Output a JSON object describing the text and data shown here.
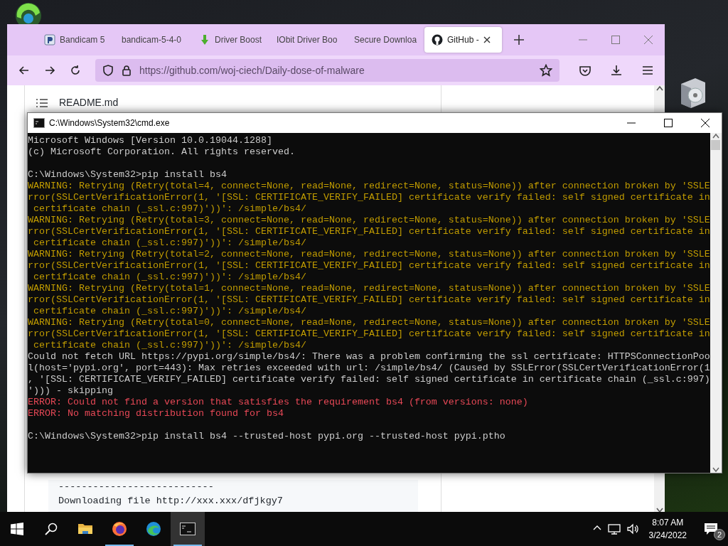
{
  "browser": {
    "tabs": [
      {
        "label": "Bandicam 5",
        "kind": "bandicam",
        "selected": false
      },
      {
        "label": "bandicam-5-4-0",
        "kind": "plain",
        "selected": false
      },
      {
        "label": "Driver Boost",
        "kind": "download",
        "selected": false
      },
      {
        "label": "IObit Driver Boo",
        "kind": "plain",
        "selected": false
      },
      {
        "label": "Secure Downloa",
        "kind": "plain",
        "selected": false
      },
      {
        "label": "GitHub - ",
        "kind": "github",
        "selected": true
      }
    ],
    "url": "https://github.com/woj-ciech/Daily-dose-of-malware",
    "readme_title": "README.md",
    "code_lines": [
      "---------------------------",
      "Downloading file http://xxx.xxx/dfjkgy7"
    ]
  },
  "cmd": {
    "title": "C:\\Windows\\System32\\cmd.exe",
    "lines": [
      {
        "kind": "normal",
        "text": "Microsoft Windows [Version 10.0.19044.1288]"
      },
      {
        "kind": "normal",
        "text": "(c) Microsoft Corporation. All rights reserved."
      },
      {
        "kind": "blank"
      },
      {
        "kind": "normal",
        "text": "C:\\Windows\\System32>pip install bs4"
      },
      {
        "kind": "warning",
        "text": "WARNING: Retrying (Retry(total=4, connect=None, read=None, redirect=None, status=None)) after connection broken by 'SSLE"
      },
      {
        "kind": "warning",
        "text": "rror(SSLCertVerificationError(1, '[SSL: CERTIFICATE_VERIFY_FAILED] certificate verify failed: self signed certificate in"
      },
      {
        "kind": "warning",
        "text": " certificate chain (_ssl.c:997)'))': /simple/bs4/"
      },
      {
        "kind": "warning",
        "text": "WARNING: Retrying (Retry(total=3, connect=None, read=None, redirect=None, status=None)) after connection broken by 'SSLE"
      },
      {
        "kind": "warning",
        "text": "rror(SSLCertVerificationError(1, '[SSL: CERTIFICATE_VERIFY_FAILED] certificate verify failed: self signed certificate in"
      },
      {
        "kind": "warning",
        "text": " certificate chain (_ssl.c:997)'))': /simple/bs4/"
      },
      {
        "kind": "warning",
        "text": "WARNING: Retrying (Retry(total=2, connect=None, read=None, redirect=None, status=None)) after connection broken by 'SSLE"
      },
      {
        "kind": "warning",
        "text": "rror(SSLCertVerificationError(1, '[SSL: CERTIFICATE_VERIFY_FAILED] certificate verify failed: self signed certificate in"
      },
      {
        "kind": "warning",
        "text": " certificate chain (_ssl.c:997)'))': /simple/bs4/"
      },
      {
        "kind": "warning",
        "text": "WARNING: Retrying (Retry(total=1, connect=None, read=None, redirect=None, status=None)) after connection broken by 'SSLE"
      },
      {
        "kind": "warning",
        "text": "rror(SSLCertVerificationError(1, '[SSL: CERTIFICATE_VERIFY_FAILED] certificate verify failed: self signed certificate in"
      },
      {
        "kind": "warning",
        "text": " certificate chain (_ssl.c:997)'))': /simple/bs4/"
      },
      {
        "kind": "warning",
        "text": "WARNING: Retrying (Retry(total=0, connect=None, read=None, redirect=None, status=None)) after connection broken by 'SSLE"
      },
      {
        "kind": "warning",
        "text": "rror(SSLCertVerificationError(1, '[SSL: CERTIFICATE_VERIFY_FAILED] certificate verify failed: self signed certificate in"
      },
      {
        "kind": "warning",
        "text": " certificate chain (_ssl.c:997)'))': /simple/bs4/"
      },
      {
        "kind": "normal",
        "text": "Could not fetch URL https://pypi.org/simple/bs4/: There was a problem confirming the ssl certificate: HTTPSConnectionPoo"
      },
      {
        "kind": "normal",
        "text": "l(host='pypi.org', port=443): Max retries exceeded with url: /simple/bs4/ (Caused by SSLError(SSLCertVerificationError(1"
      },
      {
        "kind": "normal",
        "text": ", '[SSL: CERTIFICATE_VERIFY_FAILED] certificate verify failed: self signed certificate in certificate chain (_ssl.c:997)"
      },
      {
        "kind": "normal",
        "text": "'))) - skipping"
      },
      {
        "kind": "error",
        "text": "ERROR: Could not find a version that satisfies the requirement bs4 (from versions: none)"
      },
      {
        "kind": "error",
        "text": "ERROR: No matching distribution found for bs4"
      },
      {
        "kind": "blank"
      },
      {
        "kind": "normal",
        "text": "C:\\Windows\\System32>pip install bs4 --trusted-host pypi.org --trusted-host pypi.ptho"
      }
    ]
  },
  "taskbar": {
    "apps": [
      {
        "kind": "explorer",
        "running": false,
        "active": false
      },
      {
        "kind": "firefox",
        "running": true,
        "active": false
      },
      {
        "kind": "edge",
        "running": false,
        "active": false
      },
      {
        "kind": "terminal",
        "running": true,
        "active": true
      }
    ],
    "time": "8:07 AM",
    "date": "3/24/2022",
    "notifications": "2"
  }
}
